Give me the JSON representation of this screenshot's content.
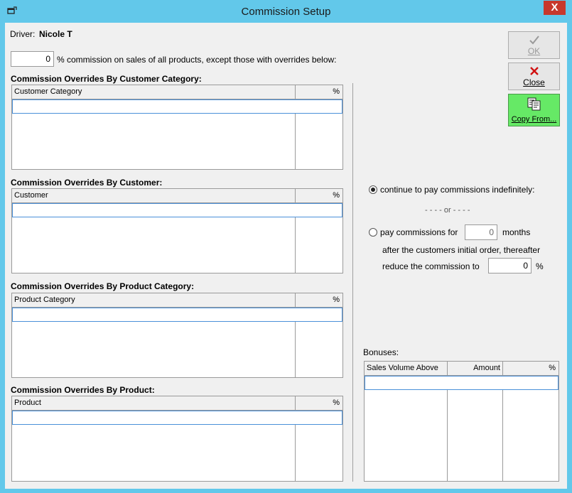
{
  "window": {
    "title": "Commission Setup",
    "close_glyph": "X"
  },
  "driver": {
    "label": "Driver:",
    "name": "Nicole T"
  },
  "base_commission": {
    "value": "0",
    "text": "% commission on sales of all products, except those with overrides below:"
  },
  "sections": [
    {
      "title": "Commission Overrides By Customer Category:",
      "col1": "Customer Category",
      "col2": "%"
    },
    {
      "title": "Commission Overrides By Customer:",
      "col1": "Customer",
      "col2": "%"
    },
    {
      "title": "Commission Overrides By Product Category:",
      "col1": "Product Category",
      "col2": "%"
    },
    {
      "title": "Commission Overrides By Product:",
      "col1": "Product",
      "col2": "%"
    }
  ],
  "buttons": {
    "ok": "OK",
    "close": "Close",
    "copy_from": "Copy From..."
  },
  "duration": {
    "option_indefinite": "continue to pay commissions indefinitely:",
    "or_text": "- - - - or - - - -",
    "option_months_prefix": "pay commissions for",
    "months_value": "0",
    "months_suffix": "months",
    "after_text": "after the customers initial order, thereafter",
    "reduce_text": "reduce the commission to",
    "reduce_value": "0",
    "percent": "%"
  },
  "bonuses": {
    "label": "Bonuses:",
    "col1": "Sales Volume Above",
    "col2": "Amount",
    "col3": "%"
  },
  "colors": {
    "titlebar": "#62c8ea",
    "close_button": "#c7382c",
    "copy_button": "#66e966",
    "selection_border": "#4a90d9"
  },
  "icons": {
    "system": "window-icon",
    "ok": "checkmark-icon",
    "close": "red-x-icon",
    "copy": "copy-documents-icon"
  }
}
